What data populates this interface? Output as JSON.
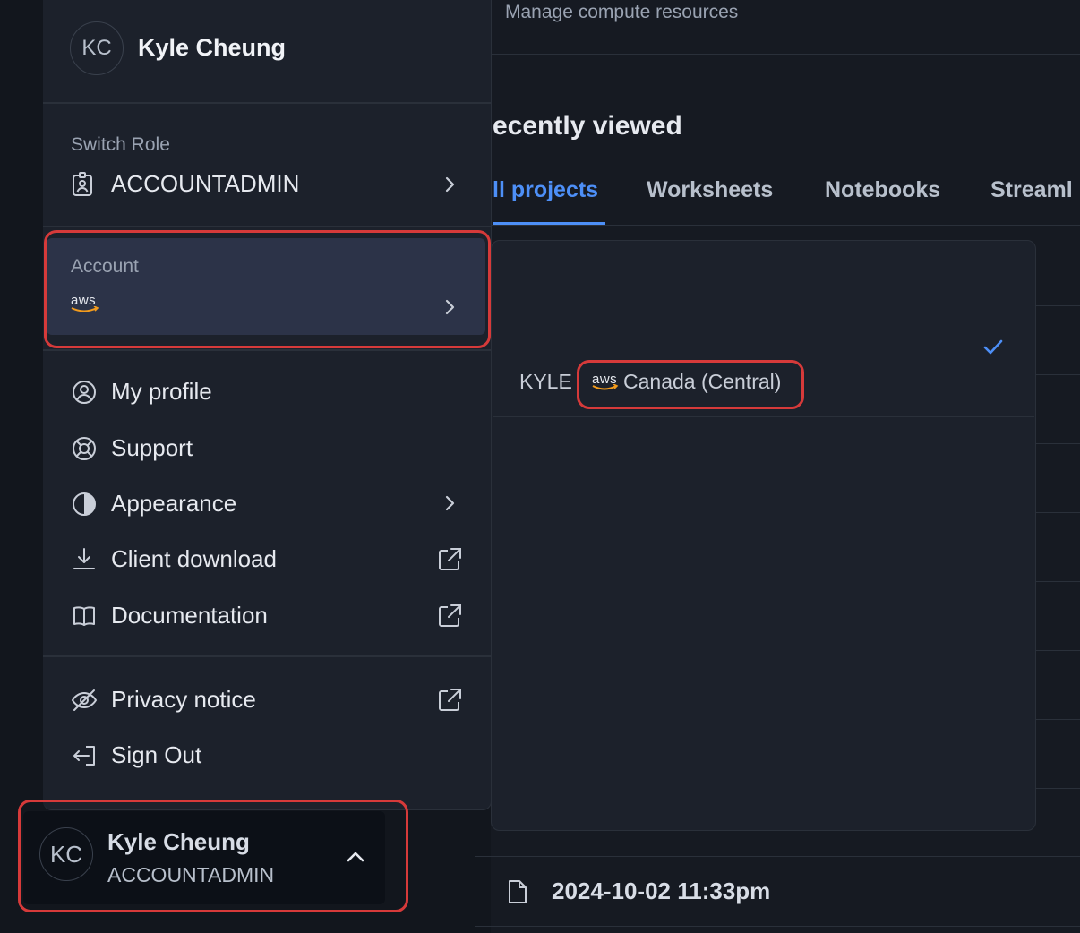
{
  "background": {
    "subtitle": "Manage compute resources",
    "heading": "ecently viewed",
    "tabs": [
      "ll projects",
      "Worksheets",
      "Notebooks",
      "Streaml"
    ],
    "last_row": "2024-10-02 11:33pm"
  },
  "menu": {
    "header": {
      "initials": "KC",
      "name": "Kyle Cheung"
    },
    "switch_role": {
      "label": "Switch Role",
      "value": "ACCOUNTADMIN"
    },
    "account": {
      "label": "Account",
      "provider": "aws"
    },
    "items": [
      {
        "label": "My profile",
        "icon": "user-circle-icon"
      },
      {
        "label": "Support",
        "icon": "lifebuoy-icon"
      },
      {
        "label": "Appearance",
        "icon": "half-circle-icon"
      },
      {
        "label": "Client download",
        "icon": "download-icon"
      },
      {
        "label": "Documentation",
        "icon": "book-icon"
      }
    ],
    "footer_items": [
      {
        "label": "Privacy notice",
        "icon": "eye-off-icon"
      },
      {
        "label": "Sign Out",
        "icon": "sign-out-icon"
      }
    ]
  },
  "account_submenu": {
    "account_name": "KYLE",
    "provider": "aws",
    "region": "Canada (Central)",
    "selected": true
  },
  "user_card": {
    "initials": "KC",
    "name": "Kyle Cheung",
    "role": "ACCOUNTADMIN"
  },
  "colors": {
    "accent": "#4d8ff7",
    "highlight": "#d63a3a",
    "aws_orange": "#f29b1d"
  }
}
